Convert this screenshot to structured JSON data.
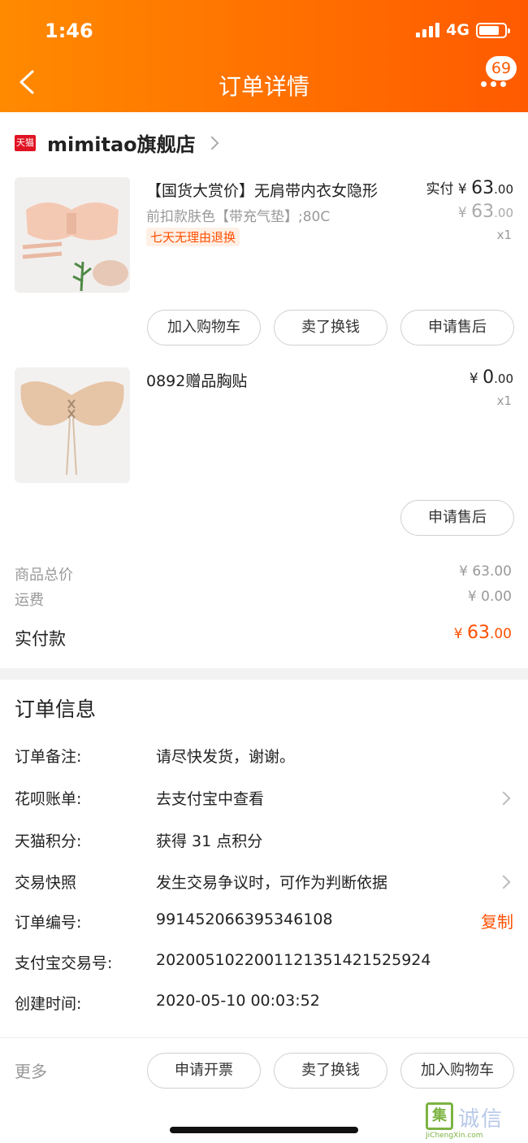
{
  "status_bar": {
    "time": "1:46",
    "network": "4G"
  },
  "header": {
    "title": "订单详情",
    "badge": "69"
  },
  "store": {
    "logo_text": "天猫",
    "name": "mimitao旗舰店"
  },
  "items": [
    {
      "title": "【国货大赏价】无肩带内衣女隐形",
      "sku": "前扣款肤色【带充气垫】;80C",
      "tag": "七天无理由退换",
      "paid_label": "实付",
      "currency": "¥",
      "paid_int": "63",
      "paid_dec": ".00",
      "orig_int": "63",
      "orig_dec": ".00",
      "qty": "x1",
      "buttons": [
        "加入购物车",
        "卖了换钱",
        "申请售后"
      ]
    },
    {
      "title": "0892赠品胸贴",
      "currency": "¥",
      "price_int": "0",
      "price_dec": ".00",
      "qty": "x1",
      "buttons": [
        "申请售后"
      ]
    }
  ],
  "summary": {
    "goods_label": "商品总价",
    "goods_val": "¥ 63.00",
    "shipping_label": "运费",
    "shipping_val": "¥ 0.00",
    "paid_label": "实付款",
    "paid_currency": "¥",
    "paid_int": "63",
    "paid_dec": ".00"
  },
  "order_info": {
    "title": "订单信息",
    "rows": [
      {
        "key": "订单备注:",
        "value": "请尽快发货，谢谢。"
      },
      {
        "key": "花呗账单:",
        "value": "去支付宝中查看"
      },
      {
        "key": "天猫积分:",
        "value": "获得 31 点积分"
      },
      {
        "key": "交易快照",
        "value": "发生交易争议时，可作为判断依据"
      },
      {
        "key": "订单编号:",
        "value": "991452066395346108",
        "action": "复制"
      },
      {
        "key": "支付宝交易号:",
        "value": "2020051022001121351421525924"
      },
      {
        "key": "创建时间:",
        "value": "2020-05-10 00:03:52"
      }
    ]
  },
  "footer": {
    "more_label": "更多",
    "buttons": [
      "申请开票",
      "卖了换钱",
      "加入购物车"
    ]
  },
  "watermark": {
    "logo": "集",
    "text": "诚信",
    "url": "JiChengXin.com"
  },
  "colors": {
    "accent": "#ff5000",
    "header_start": "#ff8a00",
    "header_end": "#ff5a00"
  }
}
